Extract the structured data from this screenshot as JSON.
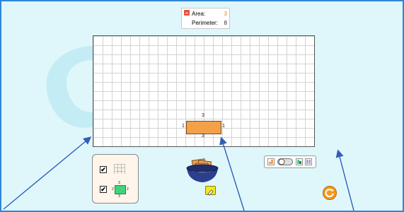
{
  "readout": {
    "area_label": "Area:",
    "area_value": "3",
    "perimeter_label": "Perimeter:",
    "perimeter_value": "8"
  },
  "shape": {
    "top_length": "3",
    "bottom_length": "3",
    "left_length": "1",
    "right_length": "1"
  },
  "options": {
    "grid_checkbox": "✔",
    "dimensions_checkbox": "✔",
    "mini_top": "3",
    "mini_bottom": "3",
    "mini_left": "2",
    "mini_right": "2"
  },
  "icons": {
    "collapse": "minus-icon",
    "eraser": "eraser-icon",
    "reset": "reset-icon",
    "bucket": "shape-bucket-icon"
  },
  "colors": {
    "shape_fill": "#f4a049",
    "background": "#dff7fb",
    "area_value": "#c8902b",
    "reset_button": "#f39a1b"
  }
}
